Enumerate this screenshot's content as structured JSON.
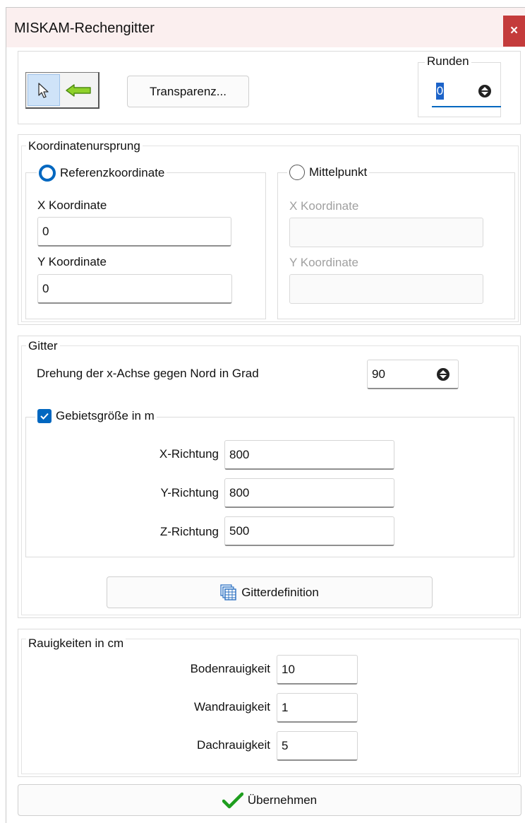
{
  "window": {
    "title": "MISKAM-Rechengitter",
    "close_label": "×"
  },
  "toolbar": {
    "pointer_icon": "cursor-arrow-icon",
    "arrow_icon": "arrow-left-icon",
    "transparency_label": "Transparenz...",
    "round_label": "Runden",
    "round_value": "0"
  },
  "origin": {
    "legend": "Koordinatenursprung",
    "reference": {
      "label": "Referenzkoordinate",
      "selected": true,
      "x_label": "X Koordinate",
      "x_value": "0",
      "y_label": "Y Koordinate",
      "y_value": "0"
    },
    "center": {
      "label": "Mittelpunkt",
      "selected": false,
      "x_label": "X Koordinate",
      "x_value": "",
      "y_label": "Y Koordinate",
      "y_value": ""
    }
  },
  "grid": {
    "legend": "Gitter",
    "rotation_label": "Drehung der x-Achse gegen Nord in Grad",
    "rotation_value": "90",
    "area": {
      "checkbox_label": "Gebietsgröße in m",
      "checked": true,
      "x_label": "X-Richtung",
      "x_value": "800",
      "y_label": "Y-Richtung",
      "y_value": "800",
      "z_label": "Z-Richtung",
      "z_value": "500"
    },
    "definition_button": "Gitterdefinition"
  },
  "roughness": {
    "legend": "Rauigkeiten in cm",
    "ground_label": "Bodenrauigkeit",
    "ground_value": "10",
    "wall_label": "Wandrauigkeit",
    "wall_value": "1",
    "roof_label": "Dachrauigkeit",
    "roof_value": "5"
  },
  "apply_button": "Übernehmen",
  "colors": {
    "accent": "#0067c0",
    "close": "#c43b3b",
    "check_green": "#1e9e1e"
  }
}
